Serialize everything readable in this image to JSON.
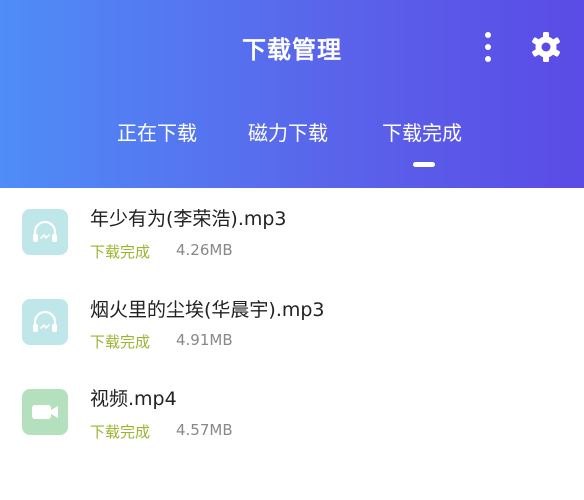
{
  "header": {
    "title": "下载管理",
    "more_icon": "more-vertical-icon",
    "settings_icon": "gear-icon",
    "gradient_start": "#4f8df7",
    "gradient_end": "#5a4be6"
  },
  "tabs": [
    {
      "label": "正在下载",
      "active": false
    },
    {
      "label": "磁力下载",
      "active": false
    },
    {
      "label": "下载完成",
      "active": true
    }
  ],
  "files": [
    {
      "name": "年少有为(李荣浩).mp3",
      "status": "下载完成",
      "size": "4.26MB",
      "icon": "headphones-icon",
      "icon_color": "#bfe6e8"
    },
    {
      "name": "烟火里的尘埃(华晨宇).mp3",
      "status": "下载完成",
      "size": "4.91MB",
      "icon": "headphones-icon",
      "icon_color": "#bfe6e8"
    },
    {
      "name": "视频.mp4",
      "status": "下载完成",
      "size": "4.57MB",
      "icon": "video-camera-icon",
      "icon_color": "#b5e0bd"
    }
  ],
  "colors": {
    "status": "#9ab531",
    "size": "#888888",
    "name": "#222222"
  }
}
